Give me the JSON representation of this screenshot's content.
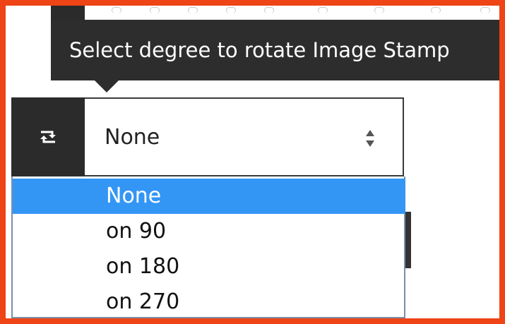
{
  "tooltip": {
    "text": "Select degree to rotate Image Stamp"
  },
  "rotate_control": {
    "icon": "rotate-icon",
    "selected_value": "None"
  },
  "dropdown": {
    "options": [
      {
        "label": "None",
        "selected": true
      },
      {
        "label": "on 90",
        "selected": false
      },
      {
        "label": "on 180",
        "selected": false
      },
      {
        "label": "on 270",
        "selected": false
      }
    ]
  },
  "colors": {
    "frame": "#ee4416",
    "dark": "#2b2b2b",
    "highlight": "#3396f5"
  }
}
